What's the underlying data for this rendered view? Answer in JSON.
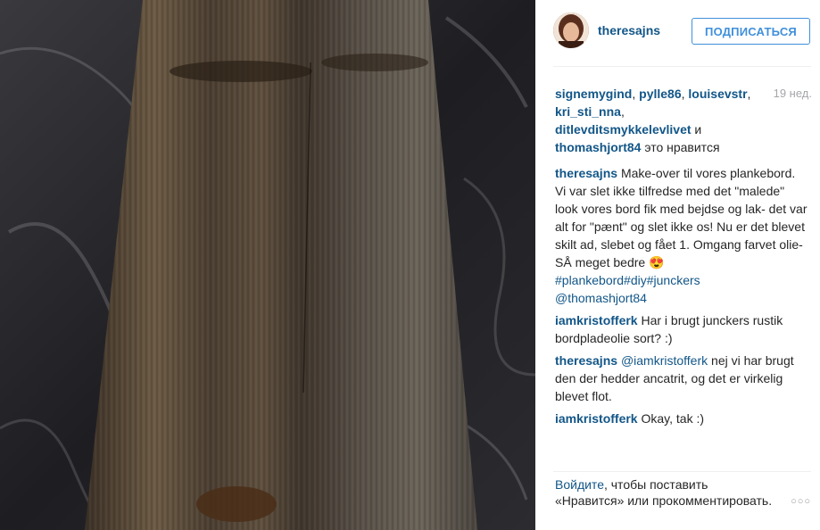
{
  "post": {
    "username": "theresajns",
    "follow_label": "ПОДПИСАТЬСЯ",
    "time_ago": "19 нед."
  },
  "likes": {
    "users": [
      "signemygind",
      "pylle86",
      "louisevstr",
      "kri_sti_nna",
      "ditlevditsmykkelevlivet",
      "thomashjort84"
    ],
    "sep1": ", ",
    "and_word": " и ",
    "suffix": " это нравится"
  },
  "comments": [
    {
      "user": "theresajns",
      "text": "Make-over til vores plankebord. Vi var slet ikke tilfredse med det \"malede\" look vores bord fik med bejdse og lak- det var alt for \"pænt\" og slet ikke os! Nu er det blevet skilt ad, slebet og fået 1. Omgang farvet olie- SÅ meget bedre 😍",
      "tags": "#plankebord#diy#junckers",
      "mention": "@thomashjort84"
    },
    {
      "user": "iamkristofferk",
      "text": "Har i brugt junckers rustik bordpladeolie sort? :)"
    },
    {
      "user": "theresajns",
      "mention": "@iamkristofferk",
      "text": " nej vi har brugt den der hedder ancatrit, og det er virkelig blevet flot."
    },
    {
      "user": "iamkristofferk",
      "text": "Okay, tak :)"
    }
  ],
  "footer": {
    "login_link": "Войдите",
    "text": ", чтобы поставить «Нравится» или прокомментировать."
  },
  "more_label": "○○○",
  "colors": {
    "link": "#125688",
    "follow": "#4090db",
    "muted": "#a5a7aa"
  }
}
